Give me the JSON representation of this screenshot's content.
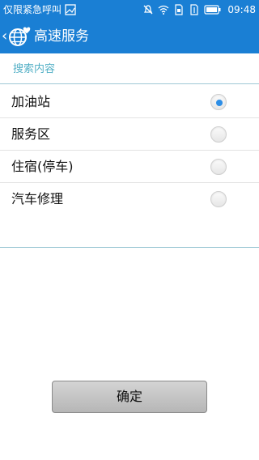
{
  "status_bar": {
    "carrier_text": "仅限紧急呼叫",
    "time": "09:48",
    "icons": [
      "image-icon",
      "mute-icon",
      "wifi-icon",
      "sim-icon",
      "data-signal-icon",
      "battery-icon"
    ]
  },
  "header": {
    "title": "高速服务",
    "back_icon": "chevron-left-icon",
    "logo_icon": "globe-heart-icon",
    "color": "#1a7fd4"
  },
  "section": {
    "title": "搜索内容",
    "title_color": "#53b0c6"
  },
  "options": [
    {
      "label": "加油站",
      "checked": true
    },
    {
      "label": "服务区",
      "checked": false
    },
    {
      "label": "住宿(停车)",
      "checked": false
    },
    {
      "label": "汽车修理",
      "checked": false
    }
  ],
  "footer": {
    "confirm_label": "确定"
  }
}
